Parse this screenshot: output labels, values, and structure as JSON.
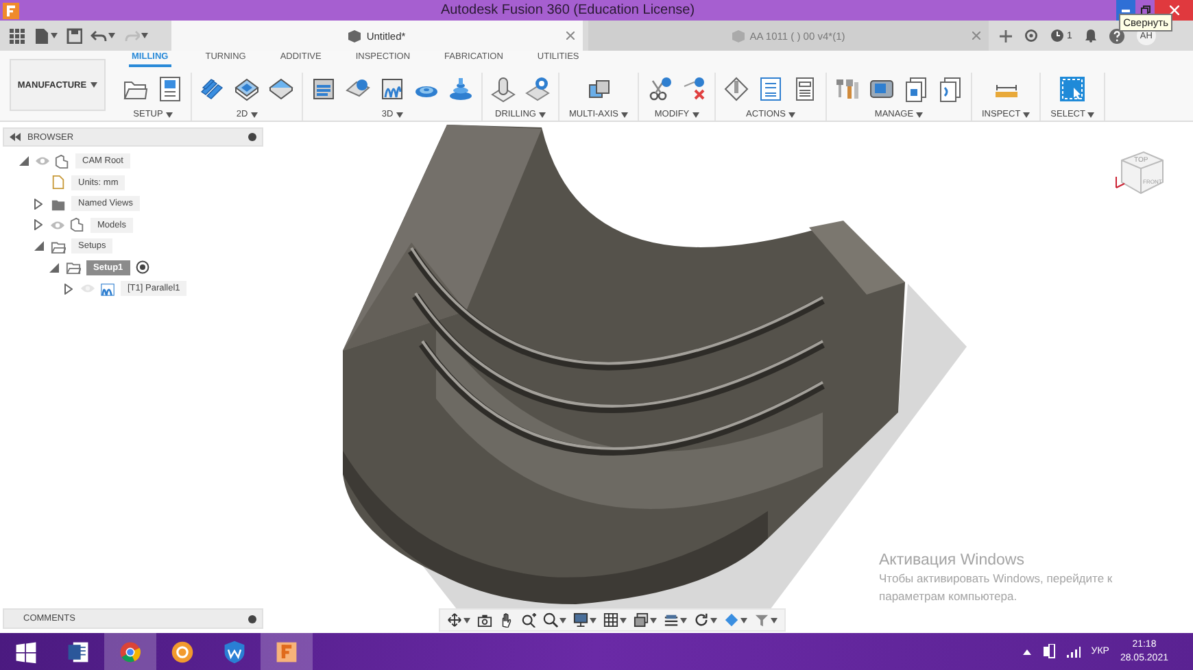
{
  "title_bar": {
    "title": "Autodesk Fusion 360 (Education License)",
    "tooltip": "Свернуть"
  },
  "quick_access": [
    {
      "kind": "grid",
      "menu": false
    },
    {
      "kind": "file",
      "menu": true
    },
    {
      "kind": "save",
      "menu": false
    },
    {
      "kind": "undo",
      "menu": true
    },
    {
      "kind": "redo",
      "menu": true
    }
  ],
  "document_tabs": [
    {
      "label": "Untitled*",
      "selected": true
    },
    {
      "label": "AA 1011 ( ) 00 v4*(1)",
      "selected": false
    }
  ],
  "job_count": "1",
  "user_initials": "AH",
  "workspace": "MANUFACTURE",
  "ribbon_tabs": [
    {
      "label": "MILLING",
      "selected": true
    },
    {
      "label": "TURNING",
      "selected": false
    },
    {
      "label": "ADDITIVE",
      "selected": false
    },
    {
      "label": "INSPECTION",
      "selected": false
    },
    {
      "label": "FABRICATION",
      "selected": false
    },
    {
      "label": "UTILITIES",
      "selected": false
    }
  ],
  "tool_groups": [
    {
      "label": "SETUP",
      "tools": [
        {
          "kind": "folder"
        },
        {
          "kind": "nc-doc"
        }
      ]
    },
    {
      "label": "2D",
      "tools": [
        {
          "kind": "adaptive"
        },
        {
          "kind": "pocket"
        },
        {
          "kind": "face"
        }
      ]
    },
    {
      "label": "3D",
      "tools": [
        {
          "kind": "adaptive-3d"
        },
        {
          "kind": "pocket-3d"
        },
        {
          "kind": "parallel"
        },
        {
          "kind": "spiral"
        },
        {
          "kind": "contour"
        }
      ]
    },
    {
      "label": "DRILLING",
      "tools": [
        {
          "kind": "drill"
        },
        {
          "kind": "hole-recognition"
        }
      ]
    },
    {
      "label": "MULTI-AXIS",
      "tools": [
        {
          "kind": "swarf"
        }
      ]
    },
    {
      "label": "MODIFY",
      "tools": [
        {
          "kind": "cut"
        },
        {
          "kind": "delete"
        }
      ]
    },
    {
      "label": "ACTIONS",
      "tools": [
        {
          "kind": "simulate"
        },
        {
          "kind": "post"
        },
        {
          "kind": "setup-sheet"
        }
      ]
    },
    {
      "label": "MANAGE",
      "tools": [
        {
          "kind": "tool-library"
        },
        {
          "kind": "machine"
        },
        {
          "kind": "template"
        },
        {
          "kind": "nc-program"
        }
      ]
    },
    {
      "label": "INSPECT",
      "tools": [
        {
          "kind": "measure"
        }
      ]
    },
    {
      "label": "SELECT",
      "tools": [
        {
          "kind": "select"
        }
      ]
    }
  ],
  "browser": {
    "title": "BROWSER",
    "tree": [
      {
        "label": "CAM Root",
        "kind": "component",
        "visible": true,
        "expanded": true,
        "selected": false,
        "children": [
          {
            "label": "Units: mm",
            "kind": "doc",
            "selected": false
          },
          {
            "label": "Named Views",
            "kind": "folder-dark",
            "expanded": false,
            "selected": false
          },
          {
            "label": "Models",
            "kind": "component",
            "visible": true,
            "expanded": false,
            "selected": false
          },
          {
            "label": "Setups",
            "kind": "folder",
            "expanded": true,
            "selected": false,
            "children": [
              {
                "label": "Setup1",
                "kind": "folder",
                "expanded": true,
                "selected": true,
                "active": true,
                "children": [
                  {
                    "label": "[T1] Parallel1",
                    "kind": "toolpath",
                    "visible": false,
                    "expanded": false,
                    "selected": false
                  }
                ]
              }
            ]
          }
        ]
      }
    ]
  },
  "view_cube": {
    "top": "TOP",
    "front": "FRONT"
  },
  "comments": {
    "title": "COMMENTS"
  },
  "navigation_tools": [
    {
      "kind": "orbit",
      "menu": true
    },
    {
      "kind": "look-at",
      "menu": false
    },
    {
      "kind": "pan",
      "menu": false
    },
    {
      "kind": "zoom",
      "menu": false
    },
    {
      "kind": "fit",
      "menu": true
    },
    {
      "kind": "display",
      "menu": true
    },
    {
      "kind": "grid",
      "menu": true
    },
    {
      "kind": "viewports",
      "menu": true
    },
    {
      "kind": "effects",
      "menu": true
    },
    {
      "kind": "refresh",
      "menu": true
    },
    {
      "kind": "visual-style",
      "menu": true
    },
    {
      "kind": "filter",
      "menu": true
    }
  ],
  "activation": {
    "title": "Активация Windows",
    "message": "Чтобы активировать Windows, перейдите к параметрам компьютера."
  },
  "taskbar": {
    "apps": [
      {
        "kind": "start",
        "running": false
      },
      {
        "kind": "word",
        "running": false
      },
      {
        "kind": "chrome",
        "running": true
      },
      {
        "kind": "sun",
        "running": false
      },
      {
        "kind": "shield",
        "running": false
      },
      {
        "kind": "fusion",
        "running": true
      }
    ],
    "language": "УКР",
    "time": "21:18",
    "date": "28.05.2021"
  }
}
